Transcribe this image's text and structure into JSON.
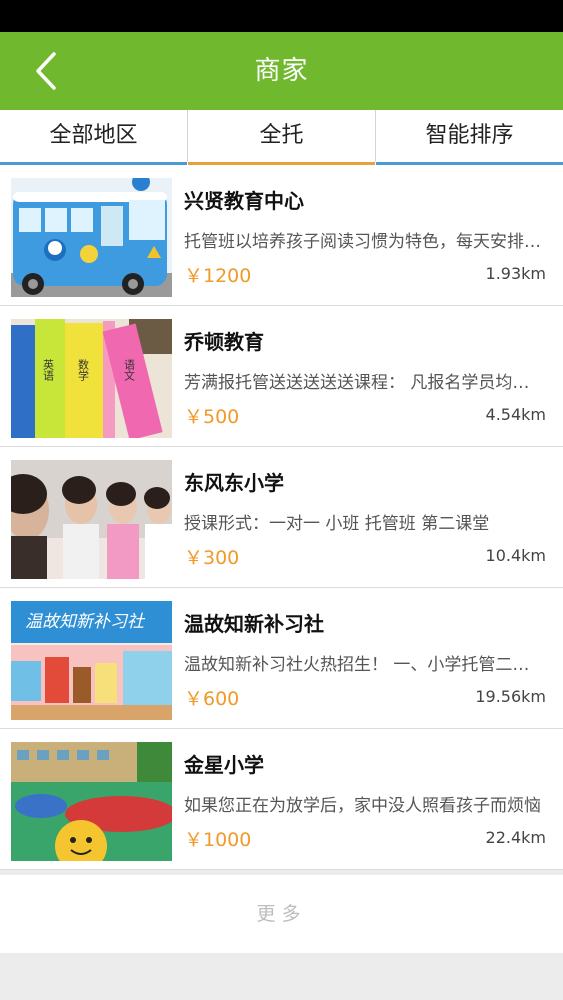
{
  "header": {
    "title": "商家"
  },
  "filters": {
    "region": "全部地区",
    "type": "全托",
    "sort": "智能排序"
  },
  "colors": {
    "nav_green": "#70b92e",
    "active_tab": "#e8a13a",
    "tab_line": "#4a9ad8",
    "price": "#f09a2a"
  },
  "icons": {
    "back": "chevron-left-icon"
  },
  "merchants": [
    {
      "name": "兴贤教育中心",
      "desc": "托管班以培养孩子阅读习惯为特色，每天安排固定的阅读时间",
      "price": "￥1200",
      "distance": "1.93km"
    },
    {
      "name": "乔顿教育",
      "desc": "芳满报托管送送送送送课程： 凡报名学员均享受接送服务",
      "price": "￥500",
      "distance": "4.54km"
    },
    {
      "name": "东风东小学",
      "desc": "授课形式：一对一  小班  托管班  第二课堂",
      "price": "￥300",
      "distance": "10.4km"
    },
    {
      "name": "温故知新补习社",
      "desc": "温故知新补习社火热招生！  一、小学托管二、初中辅导",
      "price": "￥600",
      "distance": "19.56km"
    },
    {
      "name": "金星小学",
      "desc": "如果您正在为放学后，家中没人照看孩子而烦恼",
      "price": "￥1000",
      "distance": "22.4km"
    }
  ],
  "thumb_texts": {
    "book1": "英语",
    "book2": "数学",
    "book3": "语文",
    "sign": "温故知新补习社"
  },
  "more": {
    "label": "更多"
  }
}
